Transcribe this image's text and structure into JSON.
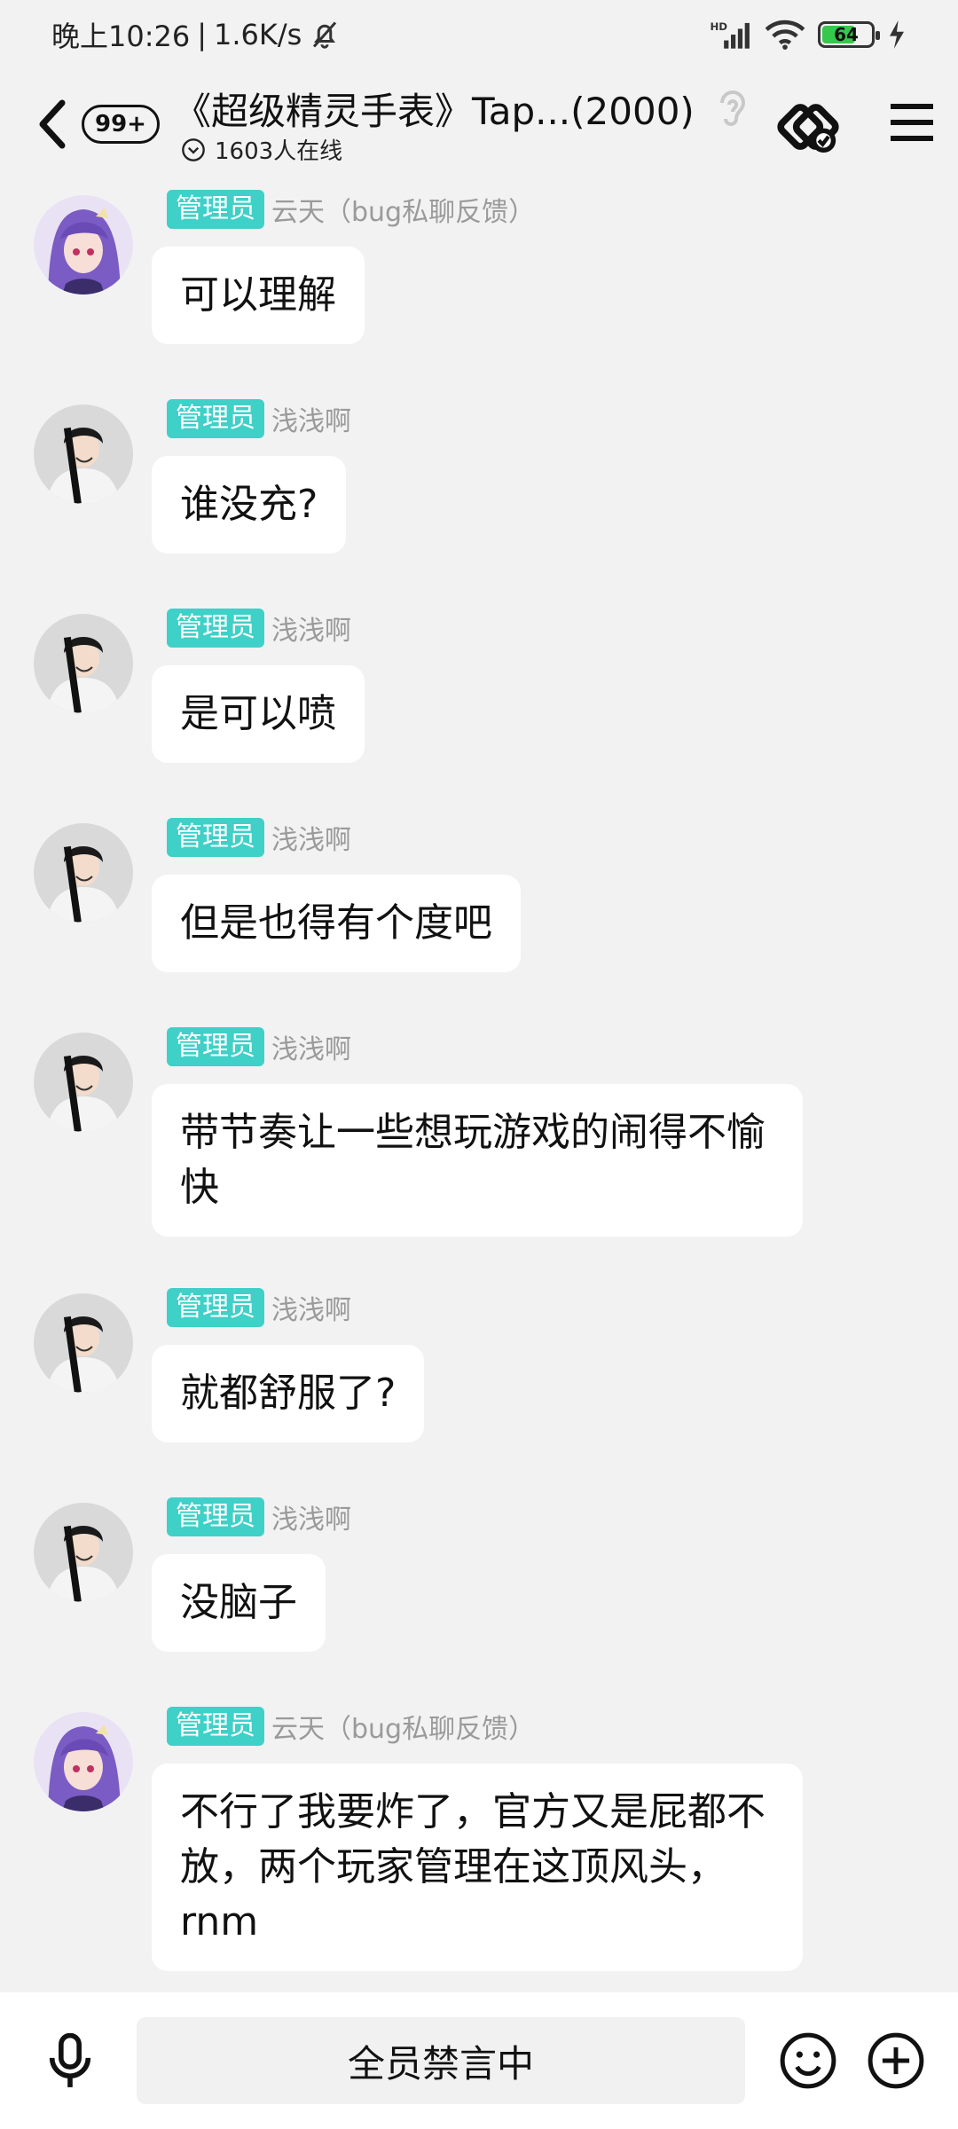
{
  "status": {
    "time": "晚上10:26",
    "speed": "1.6K/s",
    "network": "HD",
    "battery": "64"
  },
  "header": {
    "badge": "99+",
    "title": "《超级精灵手表》Tap...(2000)",
    "online": "1603人在线"
  },
  "messages": [
    {
      "role": "管理员",
      "sender": "云天（bug私聊反馈）",
      "text": "可以理解",
      "avatar": "purple-hair"
    },
    {
      "role": "管理员",
      "sender": "浅浅啊",
      "text": "谁没充?",
      "avatar": "dark-hair"
    },
    {
      "role": "管理员",
      "sender": "浅浅啊",
      "text": "是可以喷",
      "avatar": "dark-hair"
    },
    {
      "role": "管理员",
      "sender": "浅浅啊",
      "text": "但是也得有个度吧",
      "avatar": "dark-hair"
    },
    {
      "role": "管理员",
      "sender": "浅浅啊",
      "text": "带节奏让一些想玩游戏的闹得不愉快",
      "avatar": "dark-hair"
    },
    {
      "role": "管理员",
      "sender": "浅浅啊",
      "text": "就都舒服了?",
      "avatar": "dark-hair"
    },
    {
      "role": "管理员",
      "sender": "浅浅啊",
      "text": "没脑子",
      "avatar": "dark-hair"
    },
    {
      "role": "管理员",
      "sender": "云天（bug私聊反馈）",
      "text": "不行了我要炸了，官方又是屁都不放，两个玩家管理在这顶风头，rnm",
      "avatar": "purple-hair"
    }
  ],
  "input": {
    "muted_text": "全员禁言中"
  },
  "colors": {
    "background": "#f2f2f3",
    "role_badge": "#3fd0c8",
    "battery_fill": "#35c84a"
  }
}
